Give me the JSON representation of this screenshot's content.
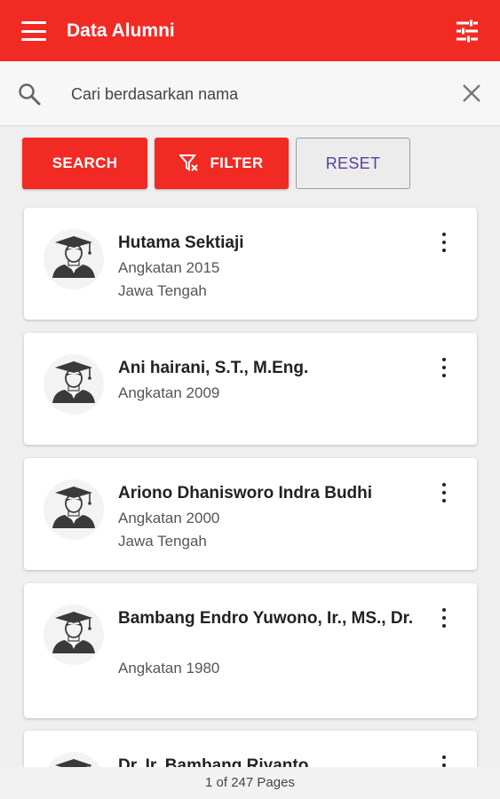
{
  "appbar": {
    "title": "Data Alumni",
    "color": "#f22a24",
    "menu_icon": "hamburger-icon",
    "tune_icon": "tune-icon"
  },
  "search": {
    "placeholder": "Cari berdasarkan nama",
    "value": ""
  },
  "buttons": {
    "search_label": "SEARCH",
    "filter_label": "FILTER",
    "reset_label": "RESET"
  },
  "alumni": [
    {
      "name": "Hutama Sektiaji",
      "year": "Angkatan 2015",
      "region": "Jawa Tengah"
    },
    {
      "name": "Ani hairani, S.T., M.Eng.",
      "year": "Angkatan 2009",
      "region": ""
    },
    {
      "name": "Ariono Dhanisworo Indra Budhi",
      "year": "Angkatan 2000",
      "region": "Jawa Tengah"
    },
    {
      "name": "Bambang Endro Yuwono, Ir., MS., Dr.",
      "year": "Angkatan 1980",
      "region": ""
    },
    {
      "name": "Dr. Ir. Bambang Riyanto",
      "year": "",
      "region": ""
    }
  ],
  "pager": {
    "text": "1 of 247 Pages"
  }
}
